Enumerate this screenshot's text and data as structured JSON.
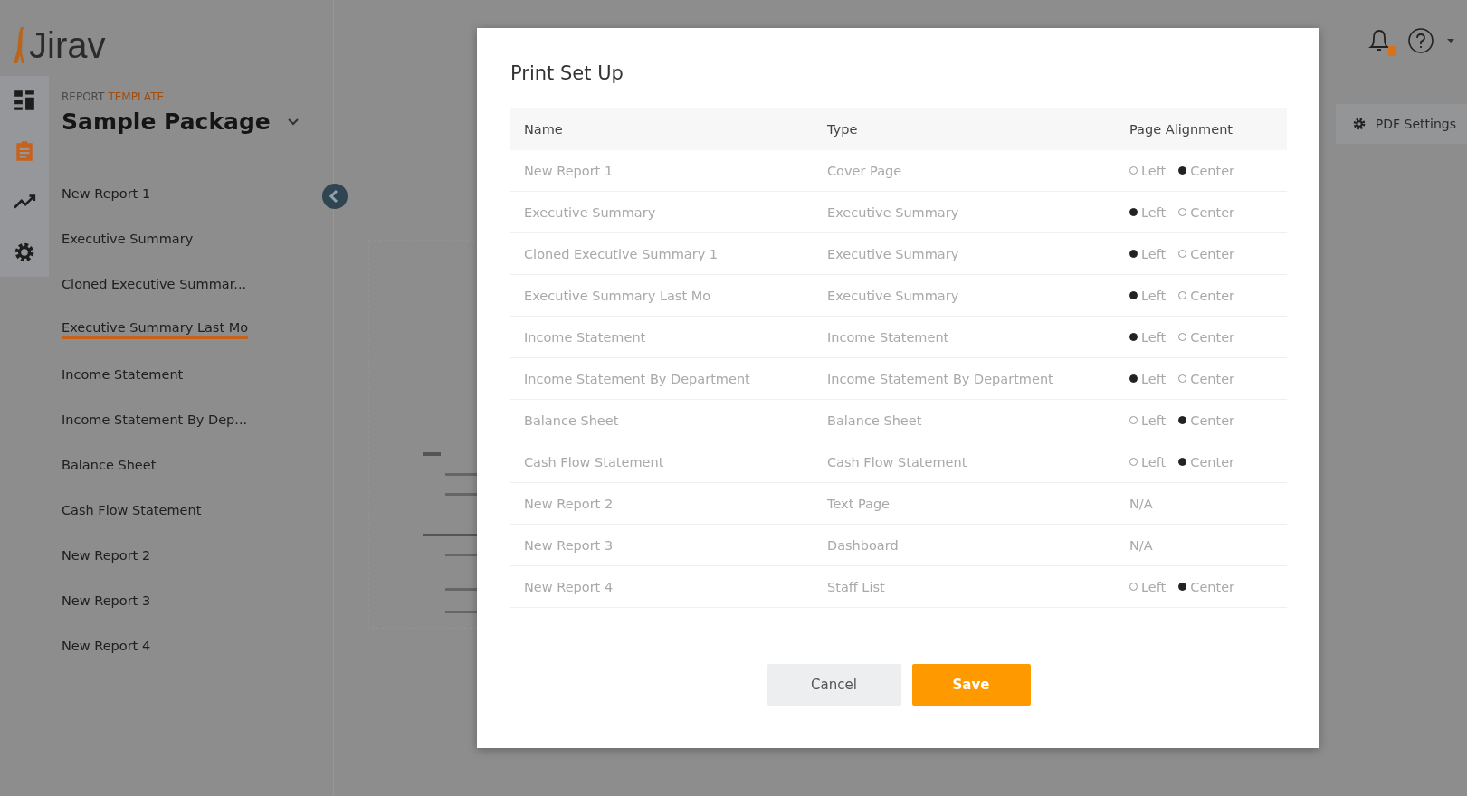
{
  "app": {
    "logo": "Jirav",
    "notifications": {
      "badge": true
    },
    "pdf_settings": "PDF Settings"
  },
  "sidebar": {
    "icons": [
      {
        "kind": "dashboard",
        "selected": false
      },
      {
        "kind": "clipboard",
        "selected": true
      },
      {
        "kind": "trend",
        "selected": false
      },
      {
        "kind": "gear",
        "selected": false
      }
    ]
  },
  "report": {
    "label_prefix": "REPORT",
    "label_suffix": "TEMPLATE",
    "title": "Sample Package",
    "items": [
      {
        "label": "New Report 1",
        "selected": false
      },
      {
        "label": "Executive Summary",
        "selected": false
      },
      {
        "label": "Cloned Executive Summar...",
        "selected": false
      },
      {
        "label": "Executive Summary Last Mo",
        "selected": true
      },
      {
        "label": "Income Statement",
        "selected": false
      },
      {
        "label": "Income Statement By Dep...",
        "selected": false
      },
      {
        "label": "Balance Sheet",
        "selected": false
      },
      {
        "label": "Cash Flow Statement",
        "selected": false
      },
      {
        "label": "New Report 2",
        "selected": false
      },
      {
        "label": "New Report 3",
        "selected": false
      },
      {
        "label": "New Report 4",
        "selected": false
      }
    ]
  },
  "dialog": {
    "title": "Print Set Up",
    "columns": [
      "Name",
      "Type",
      "Page Alignment"
    ],
    "rows": [
      {
        "name": "New Report 1",
        "type": "Cover Page",
        "alignment": {
          "kind": "radio",
          "options": [
            {
              "label": "Left",
              "selected": false
            },
            {
              "label": "Center",
              "selected": true
            }
          ]
        }
      },
      {
        "name": "Executive Summary",
        "type": "Executive Summary",
        "alignment": {
          "kind": "radio",
          "options": [
            {
              "label": "Left",
              "selected": true
            },
            {
              "label": "Center",
              "selected": false
            }
          ]
        }
      },
      {
        "name": "Cloned Executive Summary 1",
        "type": "Executive Summary",
        "alignment": {
          "kind": "radio",
          "options": [
            {
              "label": "Left",
              "selected": true
            },
            {
              "label": "Center",
              "selected": false
            }
          ]
        }
      },
      {
        "name": "Executive Summary Last Mo",
        "type": "Executive Summary",
        "alignment": {
          "kind": "radio",
          "options": [
            {
              "label": "Left",
              "selected": true
            },
            {
              "label": "Center",
              "selected": false
            }
          ]
        }
      },
      {
        "name": "Income Statement",
        "type": "Income Statement",
        "alignment": {
          "kind": "radio",
          "options": [
            {
              "label": "Left",
              "selected": true
            },
            {
              "label": "Center",
              "selected": false
            }
          ]
        }
      },
      {
        "name": "Income Statement By Department",
        "type": "Income Statement By Department",
        "alignment": {
          "kind": "radio",
          "options": [
            {
              "label": "Left",
              "selected": true
            },
            {
              "label": "Center",
              "selected": false
            }
          ]
        }
      },
      {
        "name": "Balance Sheet",
        "type": "Balance Sheet",
        "alignment": {
          "kind": "radio",
          "options": [
            {
              "label": "Left",
              "selected": false
            },
            {
              "label": "Center",
              "selected": true
            }
          ]
        }
      },
      {
        "name": "Cash Flow Statement",
        "type": "Cash Flow Statement",
        "alignment": {
          "kind": "radio",
          "options": [
            {
              "label": "Left",
              "selected": false
            },
            {
              "label": "Center",
              "selected": true
            }
          ]
        }
      },
      {
        "name": "New Report 2",
        "type": "Text Page",
        "alignment": {
          "kind": "text",
          "text": "N/A"
        }
      },
      {
        "name": "New Report 3",
        "type": "Dashboard",
        "alignment": {
          "kind": "text",
          "text": "N/A"
        }
      },
      {
        "name": "New Report 4",
        "type": "Staff List",
        "alignment": {
          "kind": "radio",
          "options": [
            {
              "label": "Left",
              "selected": false
            },
            {
              "label": "Center",
              "selected": true
            }
          ]
        }
      }
    ],
    "buttons": [
      {
        "label": "Cancel",
        "kind": "secondary"
      },
      {
        "label": "Save",
        "kind": "primary"
      }
    ]
  }
}
